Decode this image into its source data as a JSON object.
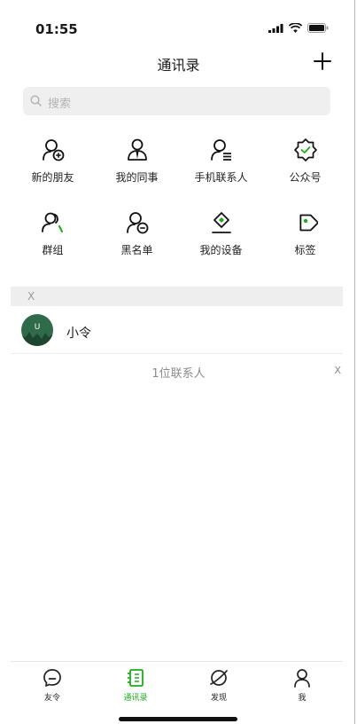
{
  "status_bar": {
    "time": "01:55"
  },
  "header": {
    "title": "通讯录"
  },
  "search": {
    "placeholder": "搜索"
  },
  "features": [
    {
      "label": "新的朋友",
      "icon": "add-friend-icon"
    },
    {
      "label": "我的同事",
      "icon": "colleague-icon"
    },
    {
      "label": "手机联系人",
      "icon": "phone-contacts-icon"
    },
    {
      "label": "公众号",
      "icon": "official-account-icon"
    },
    {
      "label": "群组",
      "icon": "group-icon"
    },
    {
      "label": "黑名单",
      "icon": "blacklist-icon"
    },
    {
      "label": "我的设备",
      "icon": "device-icon"
    },
    {
      "label": "标签",
      "icon": "tag-icon"
    }
  ],
  "section": {
    "letter": "X"
  },
  "contacts": [
    {
      "name": "小令",
      "avatar_letter": "U"
    }
  ],
  "summary": {
    "count_text": "1位联系人",
    "side_index": "X"
  },
  "tabbar": {
    "active": "通讯录",
    "items": [
      {
        "label": "友令",
        "icon": "chat-icon"
      },
      {
        "label": "通讯录",
        "icon": "contacts-icon"
      },
      {
        "label": "发现",
        "icon": "discover-icon"
      },
      {
        "label": "我",
        "icon": "profile-icon"
      }
    ]
  },
  "colors": {
    "accent": "#1aad19",
    "text": "#1a1a1a",
    "muted": "#8a8a8a"
  }
}
